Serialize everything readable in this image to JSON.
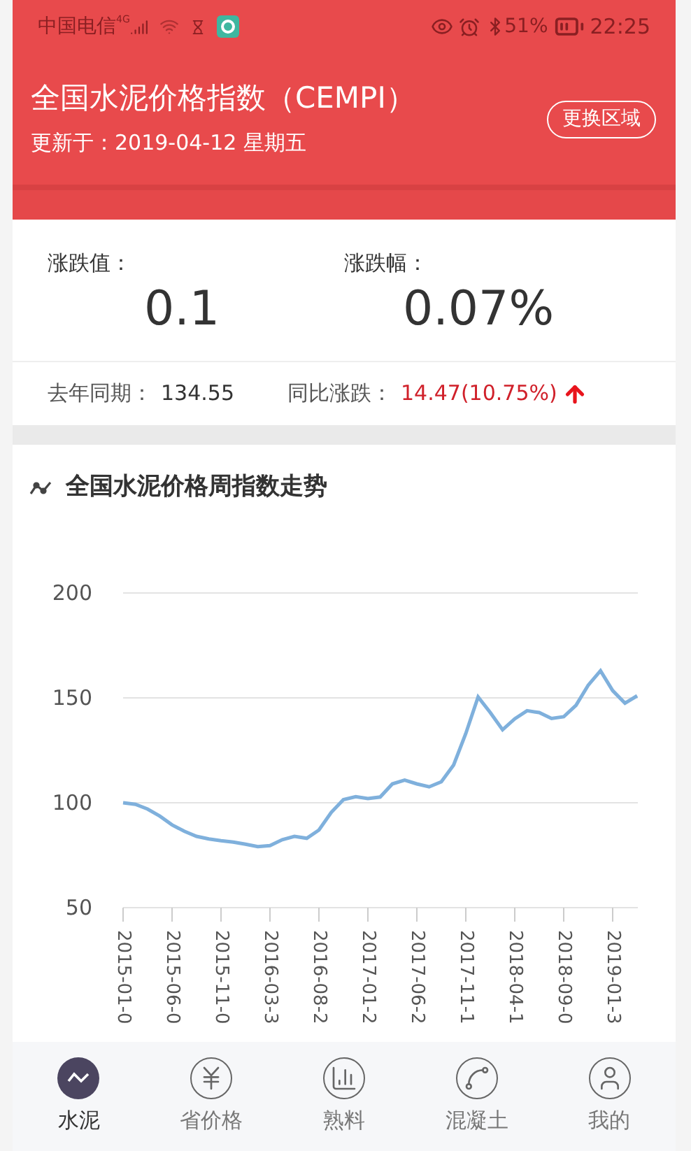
{
  "status_bar": {
    "carrier": "中国电信",
    "network": "4G",
    "battery": "51%",
    "time": "22:25"
  },
  "header": {
    "title": "全国水泥价格指数（CEMPI）",
    "updated": "更新于：2019-04-12 星期五",
    "button": "更换区域"
  },
  "summary": {
    "stats": [
      {
        "label": "涨跌值：",
        "value": "0.1"
      },
      {
        "label": "涨跌幅：",
        "value": "0.07%"
      }
    ],
    "last_year_label": "去年同期：",
    "last_year_value": "134.55",
    "yoy_label": "同比涨跌：",
    "yoy_value": "14.47(10.75%)"
  },
  "trend": {
    "title": "全国水泥价格周指数走势",
    "chart_data": {
      "type": "line",
      "categories": [
        "2015-01-0",
        null,
        null,
        null,
        "2015-06-0",
        null,
        null,
        null,
        "2015-11-0",
        null,
        null,
        null,
        "2016-03-3",
        null,
        null,
        null,
        "2016-08-2",
        null,
        null,
        null,
        "2017-01-2",
        null,
        null,
        null,
        "2017-06-2",
        null,
        null,
        null,
        "2017-11-1",
        null,
        null,
        null,
        "2018-04-1",
        null,
        null,
        null,
        "2018-09-0",
        null,
        null,
        null,
        "2019-01-3",
        null,
        null
      ],
      "series": [
        {
          "color": "#7fb0dc",
          "values": [
            100,
            99.3,
            97,
            93.6,
            89.5,
            86.4,
            84,
            82.7,
            81.9,
            81.3,
            80.3,
            79.1,
            79.6,
            82.4,
            84,
            83.1,
            87,
            95.4,
            101.5,
            102.9,
            102,
            102.7,
            109,
            110.8,
            109,
            107.6,
            110,
            118,
            133,
            150.5,
            143,
            134.8,
            140,
            143.9,
            143,
            140.2,
            141,
            146.5,
            156,
            162.9,
            153.5,
            147.5,
            151
          ]
        }
      ],
      "ylim": [
        50,
        200
      ],
      "yticks": [
        50,
        100,
        150,
        200
      ]
    }
  },
  "nav": [
    {
      "label": "水泥",
      "selected": true,
      "kind": "trend"
    },
    {
      "label": "省价格",
      "selected": false,
      "kind": "yen"
    },
    {
      "label": "熟料",
      "selected": false,
      "kind": "bars"
    },
    {
      "label": "混凝土",
      "selected": false,
      "kind": "nodes"
    },
    {
      "label": "我的",
      "selected": false,
      "kind": "user"
    }
  ]
}
